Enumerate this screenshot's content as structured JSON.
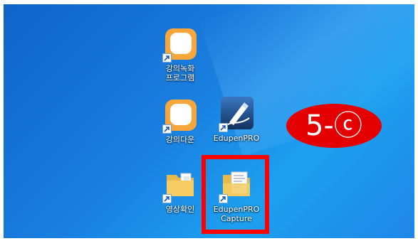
{
  "desktop_icons": [
    {
      "label": "강의녹화\n프로그램",
      "icon": "orange-app-icon"
    },
    {
      "label": "강의다운",
      "icon": "orange-app-icon"
    },
    {
      "label": "EdupenPRO",
      "icon": "edupen-pen-icon"
    },
    {
      "label": "영상확인",
      "icon": "folder-icon"
    },
    {
      "label": "EdupenPRO\nCapture",
      "icon": "folder-with-document-icon"
    }
  ],
  "annotation": {
    "badge_text": "5-ⓒ",
    "highlight_color": "#ff0000",
    "badge_color": "#e40000"
  }
}
